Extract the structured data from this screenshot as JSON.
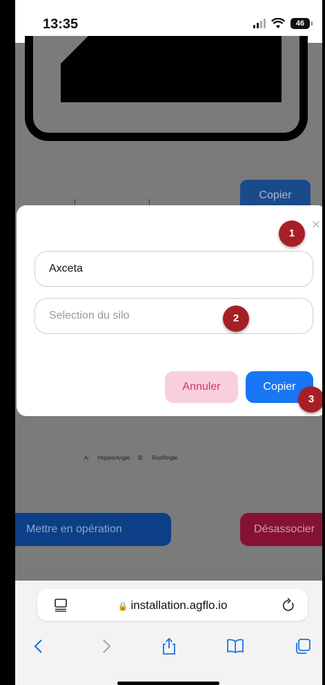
{
  "status_bar": {
    "time": "13:35",
    "battery": "46",
    "icons": [
      "signal-icon",
      "wifi-icon",
      "battery-icon"
    ]
  },
  "background": {
    "copy_label": "Copier",
    "diagram_legend": [
      "A:",
      "HopperAngle",
      "B:",
      "RoofAngle"
    ],
    "operate_label": "Mettre en opération",
    "dissociate_label": "Désassocier"
  },
  "modal": {
    "project_value": "Axceta",
    "silo_placeholder": "Selection du silo",
    "cancel_label": "Annuler",
    "copy_label": "Copier",
    "close_icon": "close-icon"
  },
  "markers": [
    "1",
    "2",
    "3"
  ],
  "browser": {
    "url": "installation.agflo.io",
    "icons": [
      "tabs-page-icon",
      "lock-icon",
      "reload-icon",
      "back-icon",
      "forward-icon",
      "share-icon",
      "bookmarks-icon",
      "tabs-icon"
    ]
  },
  "colors": {
    "primary": "#1976f5",
    "cancel_bg": "#f8d0dd",
    "cancel_text": "#d6336c",
    "marker": "#a71f26"
  }
}
